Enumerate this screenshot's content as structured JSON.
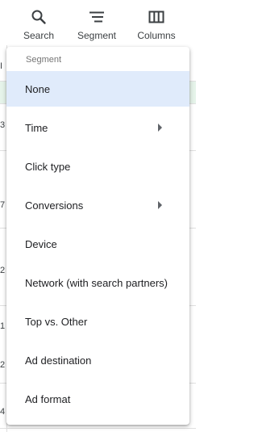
{
  "toolbar": {
    "search_label": "Search",
    "segment_label": "Segment",
    "columns_label": "Columns",
    "search_icon": "search-icon",
    "segment_icon": "segment-icon",
    "columns_icon": "columns-icon"
  },
  "background": {
    "row_digits": [
      "I",
      "3",
      "7",
      "2",
      "1",
      "2",
      "4"
    ]
  },
  "menu": {
    "header": "Segment",
    "selected": "None",
    "items": [
      {
        "label": "None",
        "submenu": false
      },
      {
        "label": "Time",
        "submenu": true
      },
      {
        "label": "Click type",
        "submenu": false
      },
      {
        "label": "Conversions",
        "submenu": true
      },
      {
        "label": "Device",
        "submenu": false
      },
      {
        "label": "Network (with search partners)",
        "submenu": false
      },
      {
        "label": "Top vs. Other",
        "submenu": false
      },
      {
        "label": "Ad destination",
        "submenu": false
      },
      {
        "label": "Ad format",
        "submenu": false
      }
    ]
  },
  "colors": {
    "selected_bg": "#e0ebfb",
    "highlight_row": "#e6f4ea"
  }
}
